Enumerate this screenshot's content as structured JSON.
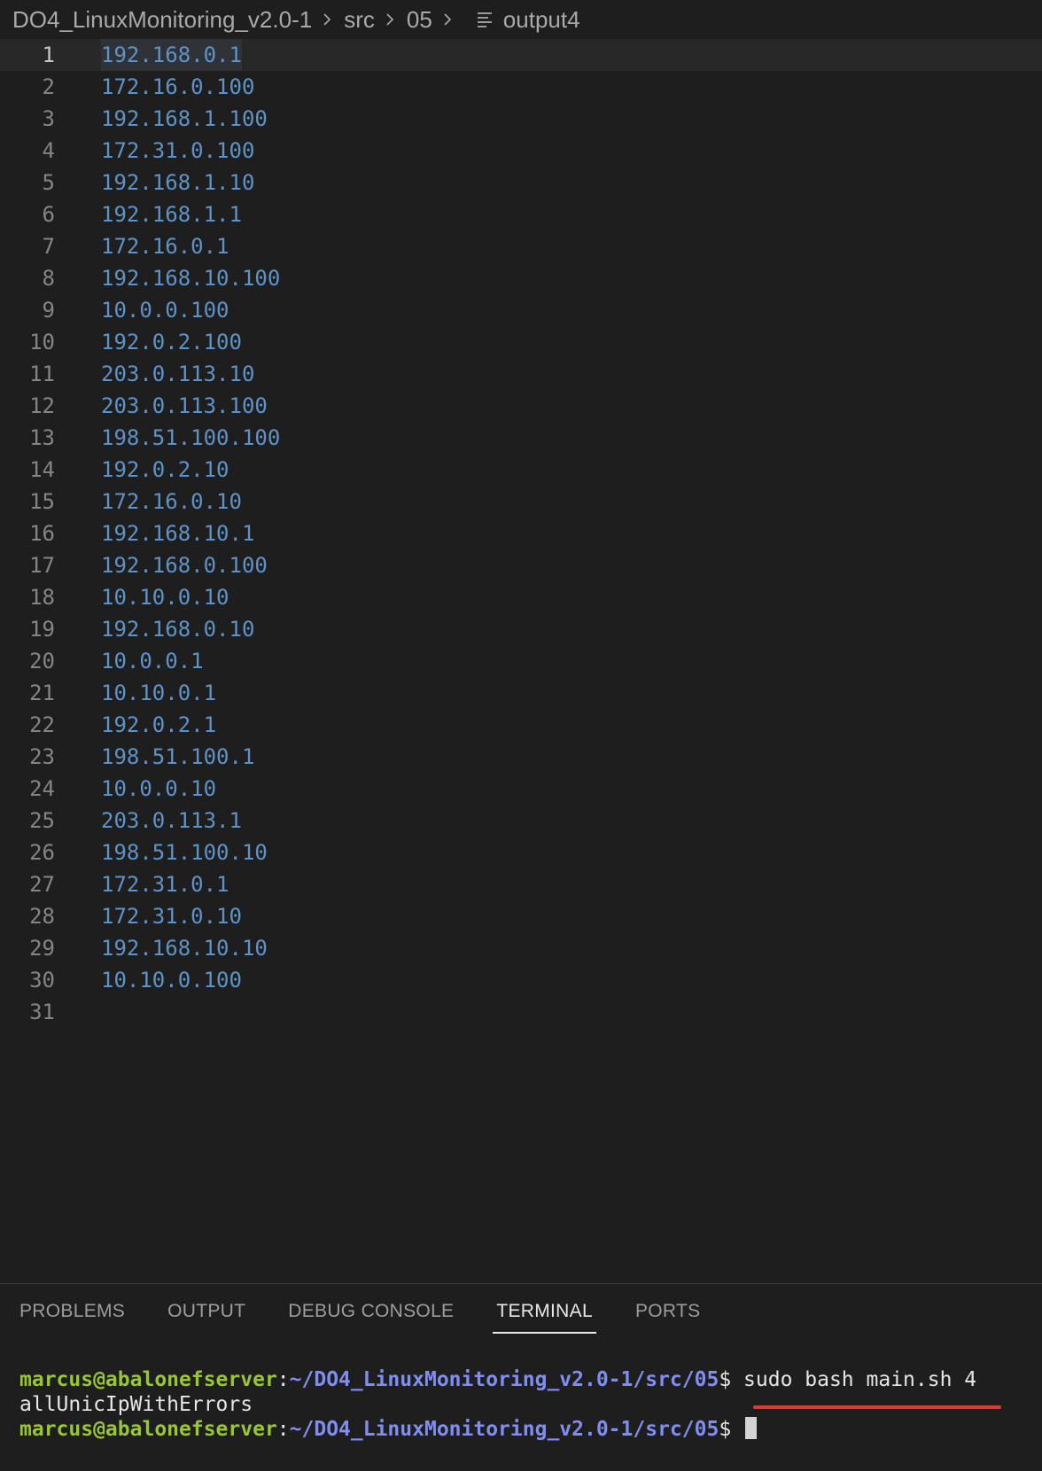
{
  "breadcrumb": {
    "items": [
      "DO4_LinuxMonitoring_v2.0-1",
      "src",
      "05"
    ],
    "file": "output4"
  },
  "editor": {
    "lines": [
      {
        "n": "1",
        "text": "192.168.0.1"
      },
      {
        "n": "2",
        "text": "172.16.0.100"
      },
      {
        "n": "3",
        "text": "192.168.1.100"
      },
      {
        "n": "4",
        "text": "172.31.0.100"
      },
      {
        "n": "5",
        "text": "192.168.1.10"
      },
      {
        "n": "6",
        "text": "192.168.1.1"
      },
      {
        "n": "7",
        "text": "172.16.0.1"
      },
      {
        "n": "8",
        "text": "192.168.10.100"
      },
      {
        "n": "9",
        "text": "10.0.0.100"
      },
      {
        "n": "10",
        "text": "192.0.2.100"
      },
      {
        "n": "11",
        "text": "203.0.113.10"
      },
      {
        "n": "12",
        "text": "203.0.113.100"
      },
      {
        "n": "13",
        "text": "198.51.100.100"
      },
      {
        "n": "14",
        "text": "192.0.2.10"
      },
      {
        "n": "15",
        "text": "172.16.0.10"
      },
      {
        "n": "16",
        "text": "192.168.10.1"
      },
      {
        "n": "17",
        "text": "192.168.0.100"
      },
      {
        "n": "18",
        "text": "10.10.0.10"
      },
      {
        "n": "19",
        "text": "192.168.0.10"
      },
      {
        "n": "20",
        "text": "10.0.0.1"
      },
      {
        "n": "21",
        "text": "10.10.0.1"
      },
      {
        "n": "22",
        "text": "192.0.2.1"
      },
      {
        "n": "23",
        "text": "198.51.100.1"
      },
      {
        "n": "24",
        "text": "10.0.0.10"
      },
      {
        "n": "25",
        "text": "203.0.113.1"
      },
      {
        "n": "26",
        "text": "198.51.100.10"
      },
      {
        "n": "27",
        "text": "172.31.0.1"
      },
      {
        "n": "28",
        "text": "172.31.0.10"
      },
      {
        "n": "29",
        "text": "192.168.10.10"
      },
      {
        "n": "30",
        "text": "10.10.0.100"
      },
      {
        "n": "31",
        "text": ""
      }
    ]
  },
  "panel": {
    "tabs": [
      {
        "label": "PROBLEMS",
        "active": false
      },
      {
        "label": "OUTPUT",
        "active": false
      },
      {
        "label": "DEBUG CONSOLE",
        "active": false
      },
      {
        "label": "TERMINAL",
        "active": true
      },
      {
        "label": "PORTS",
        "active": false
      }
    ]
  },
  "terminal": {
    "user_host": "marcus@abalonefserver",
    "colon": ":",
    "path": "~/DO4_LinuxMonitoring_v2.0-1/src/05",
    "dollar": "$",
    "command": "sudo bash main.sh 4",
    "output": "allUnicIpWithErrors"
  },
  "colors": {
    "editor_bg": "#1e1e1e",
    "code_text": "#5f93c7",
    "prompt_user": "#98c635",
    "prompt_path": "#7f8ef0",
    "annotation_underline": "#e03a2f"
  }
}
